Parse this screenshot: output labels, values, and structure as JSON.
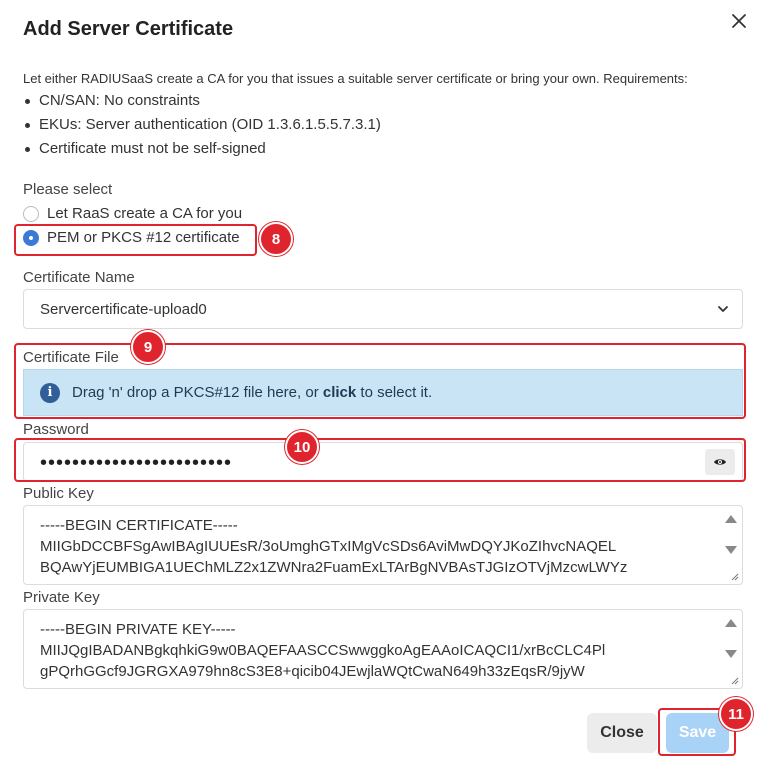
{
  "dialog": {
    "title": "Add Server Certificate",
    "close_icon": "close-icon"
  },
  "intro": {
    "text": "Let either RADIUSaaS create a CA for you that issues a suitable server certificate or bring your own. Requirements:",
    "requirements": [
      "CN/SAN: No constraints",
      "EKUs: Server authentication (OID 1.3.6.1.5.5.7.3.1)",
      "Certificate must not be self-signed"
    ]
  },
  "selection": {
    "label": "Please select",
    "options": [
      {
        "label": "Let RaaS create a CA for you",
        "checked": false
      },
      {
        "label": "PEM or PKCS #12 certificate",
        "checked": true
      }
    ]
  },
  "certificate_name": {
    "label": "Certificate Name",
    "value": "Servercertificate-upload0"
  },
  "certificate_file": {
    "label": "Certificate File",
    "dropzone_prefix": "Drag 'n' drop a PKCS#12 file here, or ",
    "dropzone_bold": "click",
    "dropzone_suffix": " to select it."
  },
  "password": {
    "label": "Password",
    "masked_value": "••••••••••••••••••••••••",
    "toggle_icon": "eye-icon"
  },
  "public_key": {
    "label": "Public Key",
    "lines": [
      "-----BEGIN CERTIFICATE-----",
      "MIIGbDCCBFSgAwIBAgIUUEsR/3oUmghGTxIMgVcSDs6AviMwDQYJKoZIhvcNAQEL",
      "BQAwYjEUMBIGA1UEChMLZ2x1ZWNra2FuamExLTArBgNVBAsTJGIzOTVjMzcwLWYz"
    ]
  },
  "private_key": {
    "label": "Private Key",
    "lines": [
      "-----BEGIN PRIVATE KEY-----",
      "MIIJQgIBADANBgkqhkiG9w0BAQEFAASCCSwwggkoAgEAAoICAQCI1/xrBcCLC4Pl",
      "gPQrhGGcf9JGRGXA979hn8cS3E8+qicib04JEwjlaWQtCwaN649h33zEqsR/9jyW"
    ]
  },
  "buttons": {
    "close": "Close",
    "save": "Save"
  },
  "annotations": {
    "step8": "8",
    "step9": "9",
    "step10": "10",
    "step11": "11"
  },
  "colors": {
    "accent": "#3b7bd6",
    "annotation": "#e0242d",
    "dropzone": "#c9e4f5",
    "save_disabled": "#a9d2f7"
  }
}
